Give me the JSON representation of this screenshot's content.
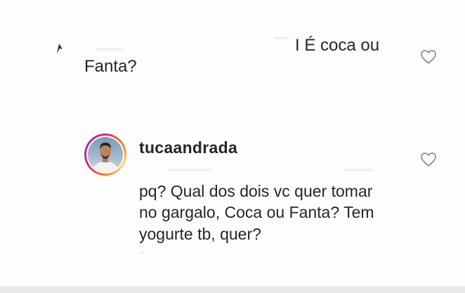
{
  "top_comment": {
    "line1": "I É coca ou",
    "line2": "Fanta?",
    "like_icon": "heart-outline-icon"
  },
  "reply": {
    "username": "tucaandrada",
    "lines": [
      "pq? Qual dos dois vc quer tomar",
      "no gargalo, Coca ou Fanta? Tem",
      "yogurte tb, quer?"
    ],
    "like_icon": "heart-outline-icon"
  },
  "colors": {
    "text": "#262626",
    "background": "#fdfdfd",
    "icon": "#8e8e8e",
    "story_ring_start": "#d62976",
    "story_ring_end": "#feda75"
  }
}
